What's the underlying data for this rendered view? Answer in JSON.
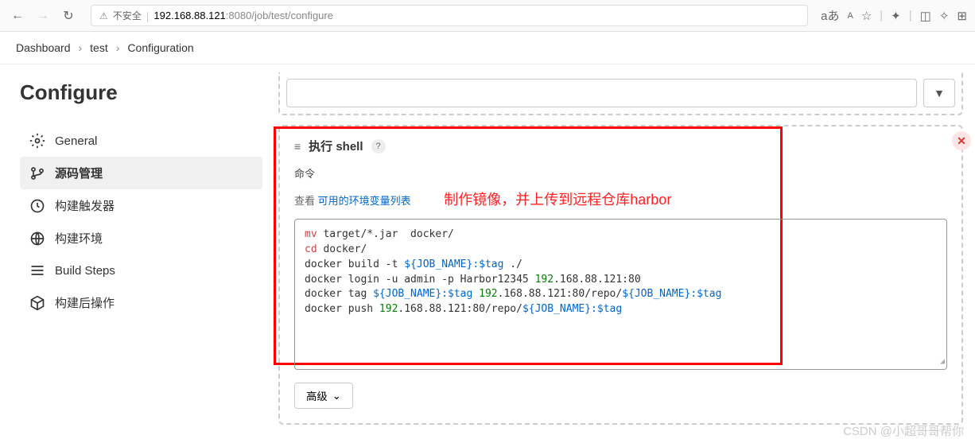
{
  "browser": {
    "insecure_label": "不安全",
    "url_host": "192.168.88.121",
    "url_port": ":8080",
    "url_path": "/job/test/configure",
    "aa_icon": "aあ",
    "AA_icon": "A",
    "star_icon": "☆"
  },
  "breadcrumb": {
    "items": [
      "Dashboard",
      "test",
      "Configuration"
    ]
  },
  "sidebar": {
    "title": "Configure",
    "items": [
      {
        "label": "General"
      },
      {
        "label": "源码管理"
      },
      {
        "label": "构建触发器"
      },
      {
        "label": "构建环境"
      },
      {
        "label": "Build Steps"
      },
      {
        "label": "构建后操作"
      }
    ]
  },
  "shell": {
    "title": "执行 shell",
    "help": "?",
    "cmd_label": "命令",
    "see_label": "查看",
    "env_link": "可用的环境变量列表",
    "annotation": "制作镜像，并上传到远程仓库harbor",
    "code": {
      "l1a": "mv",
      "l1b": " target/*.jar  docker/",
      "l2a": "cd",
      "l2b": " docker/",
      "l3a": "docker build -t ",
      "l3b": "${JOB_NAME}:$tag",
      "l3c": " ./",
      "l4a": "docker login -u admin -p Harbor12345 ",
      "l4b": "192",
      "l4c": ".168.88.121:80",
      "l5a": "docker tag ",
      "l5b": "${JOB_NAME}:$tag",
      "l5c": " ",
      "l5d": "192",
      "l5e": ".168.88.121:80/repo/",
      "l5f": "${JOB_NAME}:$tag",
      "l6a": "docker push ",
      "l6b": "192",
      "l6c": ".168.88.121:80/repo/",
      "l6d": "${JOB_NAME}:$tag"
    }
  },
  "advanced_btn": "高级",
  "watermark": "CSDN @小超哥哥帮你"
}
